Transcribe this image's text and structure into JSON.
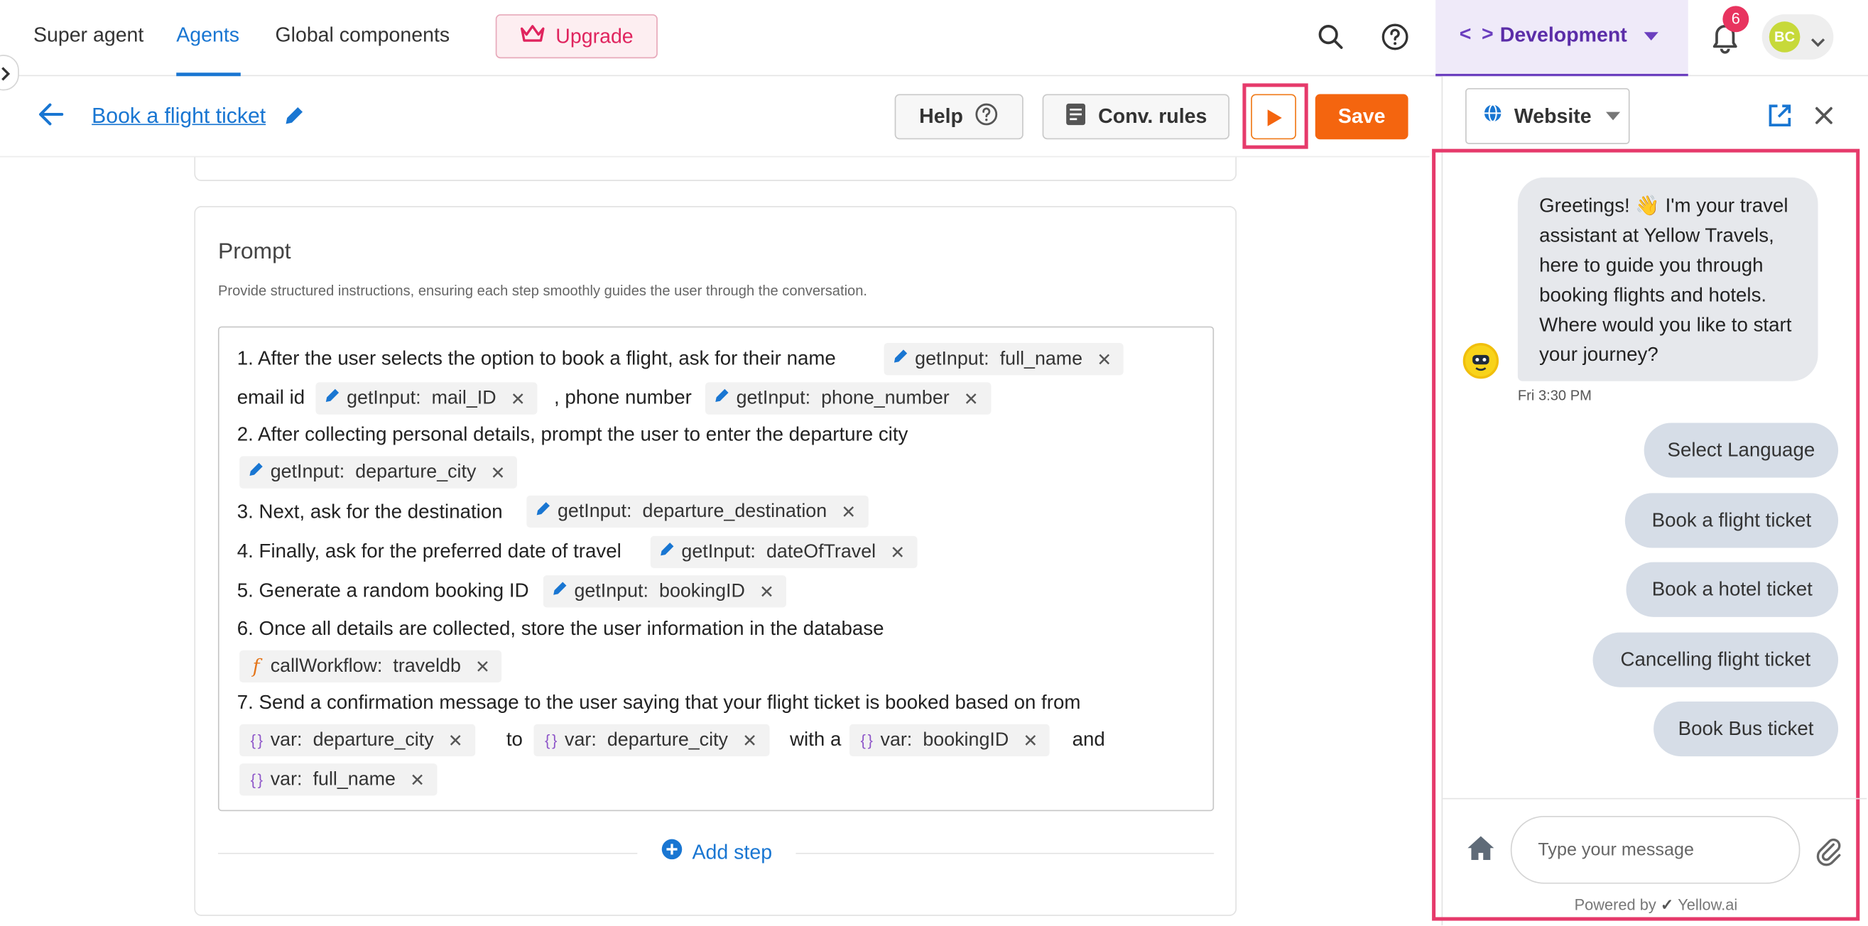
{
  "topnav": {
    "links": [
      "Super agent",
      "Agents",
      "Global components"
    ],
    "upgrade_label": "Upgrade",
    "environment": {
      "code_glyph": "< >",
      "label": "Development"
    },
    "notification_count": "6",
    "user_initials": "BC"
  },
  "editor": {
    "title": "Book a flight ticket",
    "help_label": "Help",
    "conv_rules_label": "Conv. rules",
    "save_label": "Save"
  },
  "prompt": {
    "title": "Prompt",
    "description": "Provide structured instructions, ensuring each step smoothly guides the user through the conversation.",
    "lines": [
      "1. After the user selects the option to book a flight, ask for their name",
      "email id",
      ", phone number",
      "2. After collecting personal details, prompt the user to enter the departure city",
      "3. Next, ask for the destination",
      "4. Finally, ask for the preferred date of travel",
      "5. Generate a random booking ID",
      "6. Once all details are collected, store the user information in the database",
      "7. Send a confirmation message to the user saying that your flight ticket is booked based on from",
      "to",
      "with a",
      "and"
    ],
    "tags": [
      {
        "kind": "getInput:",
        "value": "full_name"
      },
      {
        "kind": "getInput:",
        "value": "mail_ID"
      },
      {
        "kind": "getInput:",
        "value": "phone_number"
      },
      {
        "kind": "getInput:",
        "value": "departure_city"
      },
      {
        "kind": "getInput:",
        "value": "departure_destination"
      },
      {
        "kind": "getInput:",
        "value": "dateOfTravel"
      },
      {
        "kind": "getInput:",
        "value": "bookingID"
      },
      {
        "kind": "callWorkflow:",
        "value": "traveldb"
      },
      {
        "kind": "var:",
        "value": "departure_city"
      },
      {
        "kind": "var:",
        "value": "departure_city"
      },
      {
        "kind": "var:",
        "value": "bookingID"
      },
      {
        "kind": "var:",
        "value": "full_name"
      }
    ],
    "icon_glyphs": {
      "brace": "{ }",
      "fx": "f"
    },
    "add_step_label": "Add step"
  },
  "preview": {
    "channel_label": "Website",
    "greeting": "Greetings! 👋 I'm your travel assistant at Yellow Travels, here to guide you through booking flights and hotels. Where would you like to start your journey?",
    "timestamp": "Fri 3:30 PM",
    "quick_replies": [
      "Select Language",
      "Book a flight ticket",
      "Book a hotel ticket",
      "Cancelling flight ticket",
      "Book Bus ticket"
    ],
    "input_placeholder": "Type your message",
    "powered_by": "Powered by",
    "brand": "Yellow.ai"
  },
  "colors": {
    "accent_blue": "#1976d2",
    "save_orange": "#f4650f",
    "highlight_pink": "#e63a6b",
    "env_purple": "#6b3fbf",
    "quick_reply_bg": "#d6dde7"
  }
}
